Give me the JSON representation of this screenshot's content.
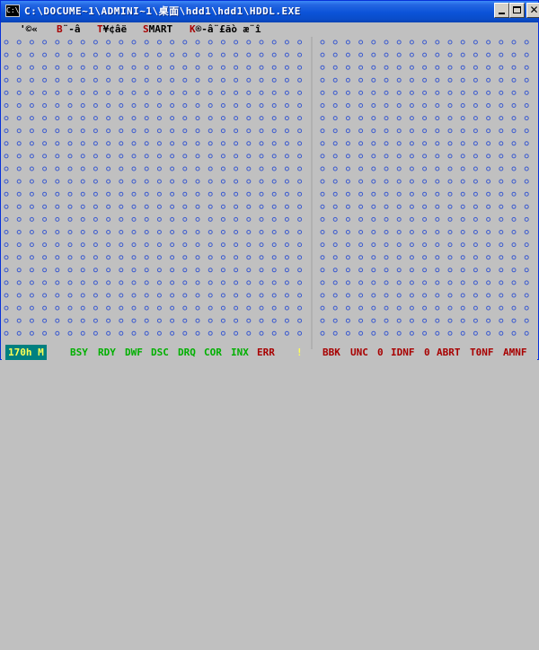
{
  "window": {
    "title": "C:\\DOCUME~1\\ADMINI~1\\桌面\\hdd1\\hdd1\\HDDL.EXE",
    "icon_label": "C:\\"
  },
  "menu": {
    "items": [
      {
        "prefix": "",
        "hot": "",
        "rest": "'©«"
      },
      {
        "prefix": "",
        "hot": "B",
        "rest": "¨-â"
      },
      {
        "prefix": "",
        "hot": "T",
        "rest": "¥¢âë"
      },
      {
        "prefix": "",
        "hot": "S",
        "rest": "MART"
      },
      {
        "prefix": "",
        "hot": "K",
        "rest": "®-â¨£ãò æ¨î"
      }
    ]
  },
  "surface_grid": {
    "dot_color": "#3a5ad0",
    "left_cols": 24,
    "right_cols": 17,
    "rows": 24
  },
  "status": {
    "mode": "170h M",
    "flags_green": [
      "BSY",
      "RDY",
      "DWF",
      "DSC",
      "DRQ",
      "COR",
      "INX"
    ],
    "flag_err": "ERR",
    "flag_excl": "!",
    "flags_red": [
      "BBK",
      "UNC",
      "0",
      "IDNF",
      "0",
      "ABRT",
      "T0NF",
      "AMNF"
    ]
  },
  "colors": {
    "titlebar": "#0b53d8",
    "console_bg": "#c0c0c0",
    "hotkey": "#a80000",
    "flag_green": "#00b000",
    "flag_red": "#a80000",
    "mode_bg": "#008080"
  }
}
